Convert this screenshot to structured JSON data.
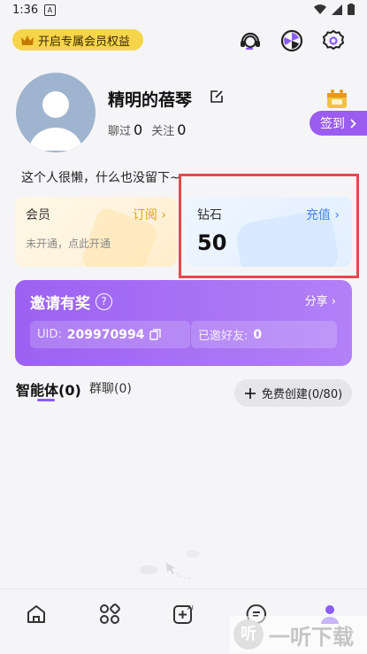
{
  "status_bar": {
    "time": "1:36",
    "notif_glyph": "A"
  },
  "header": {
    "vip_pill": "开启专属会员权益"
  },
  "profile": {
    "name": "精明的蓓琴",
    "stats": [
      {
        "label": "聊过",
        "value": "0"
      },
      {
        "label": "关注",
        "value": "0"
      }
    ],
    "signin_label": "签到",
    "bio": "这个人很懒，什么也没留下~"
  },
  "member_card": {
    "title": "会员",
    "link": "订阅",
    "subtitle": "未开通，点此开通"
  },
  "diamond_card": {
    "title": "钻石",
    "link": "充值",
    "amount": "50"
  },
  "invite": {
    "title": "邀请有奖",
    "share": "分享",
    "uid_label": "UID:",
    "uid_value": "209970994",
    "invited_label": "已邀好友:",
    "invited_value": "0"
  },
  "tabs": [
    {
      "label": "智能体(0)",
      "active": true
    },
    {
      "label": "群聊(0)",
      "active": false
    }
  ],
  "create_button": "免费创建(0/80)",
  "bottom_nav": [
    {
      "icon": "home-icon"
    },
    {
      "icon": "apps-grid-icon"
    },
    {
      "icon": "ai-create-icon"
    },
    {
      "icon": "chat-icon"
    },
    {
      "icon": "profile-icon",
      "active": true
    }
  ],
  "watermark": {
    "text": "一听下载",
    "logo": "听"
  },
  "colors": {
    "accent": "#9b5cf0",
    "vip_yellow": "#f6d54a",
    "link_blue": "#4b86f0",
    "link_gold": "#e3a11c",
    "highlight": "#e5484d"
  }
}
